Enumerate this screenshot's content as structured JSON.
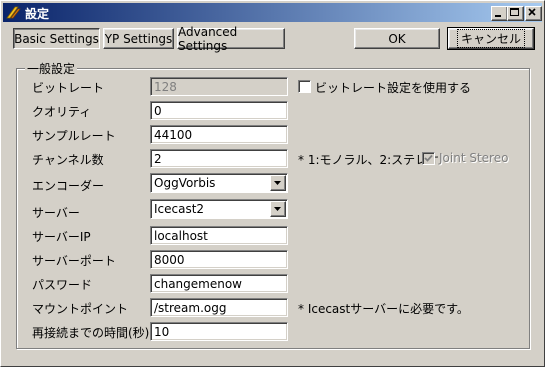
{
  "window": {
    "title": "設定"
  },
  "tabs": [
    {
      "label": "Basic Settings"
    },
    {
      "label": "YP Settings"
    },
    {
      "label": "Advanced Settings"
    }
  ],
  "buttons": {
    "ok": "OK",
    "cancel": "キャンセル"
  },
  "group": {
    "title": "一般設定"
  },
  "fields": {
    "bitrate": {
      "label": "ビットレート",
      "value": "128"
    },
    "quality": {
      "label": "クオリティ",
      "value": "0"
    },
    "samplerate": {
      "label": "サンプルレート",
      "value": "44100"
    },
    "channels": {
      "label": "チャンネル数",
      "value": "2"
    },
    "encoder": {
      "label": "エンコーダー",
      "value": "OggVorbis"
    },
    "server": {
      "label": "サーバー",
      "value": "Icecast2"
    },
    "server_ip": {
      "label": "サーバーIP",
      "value": "localhost"
    },
    "server_port": {
      "label": "サーバーポート",
      "value": "8000"
    },
    "password": {
      "label": "パスワード",
      "value": "changemenow"
    },
    "mountpoint": {
      "label": "マウントポイント",
      "value": "/stream.ogg"
    },
    "reconnect": {
      "label": "再接続までの時間(秒)",
      "value": "10"
    }
  },
  "checkboxes": {
    "use_bitrate": {
      "label": "ビットレート設定を使用する",
      "checked": false
    },
    "joint_stereo": {
      "label": "Joint Stereo",
      "checked": true,
      "enabled": false
    }
  },
  "notes": {
    "channels": "* 1:モノラル、2:ステレオ",
    "mountpoint": "* Icecastサーバーに必要です。"
  },
  "colors": {
    "titlebar_start": "#0a246a",
    "titlebar_end": "#a6caf0",
    "face": "#d4d0c8"
  }
}
